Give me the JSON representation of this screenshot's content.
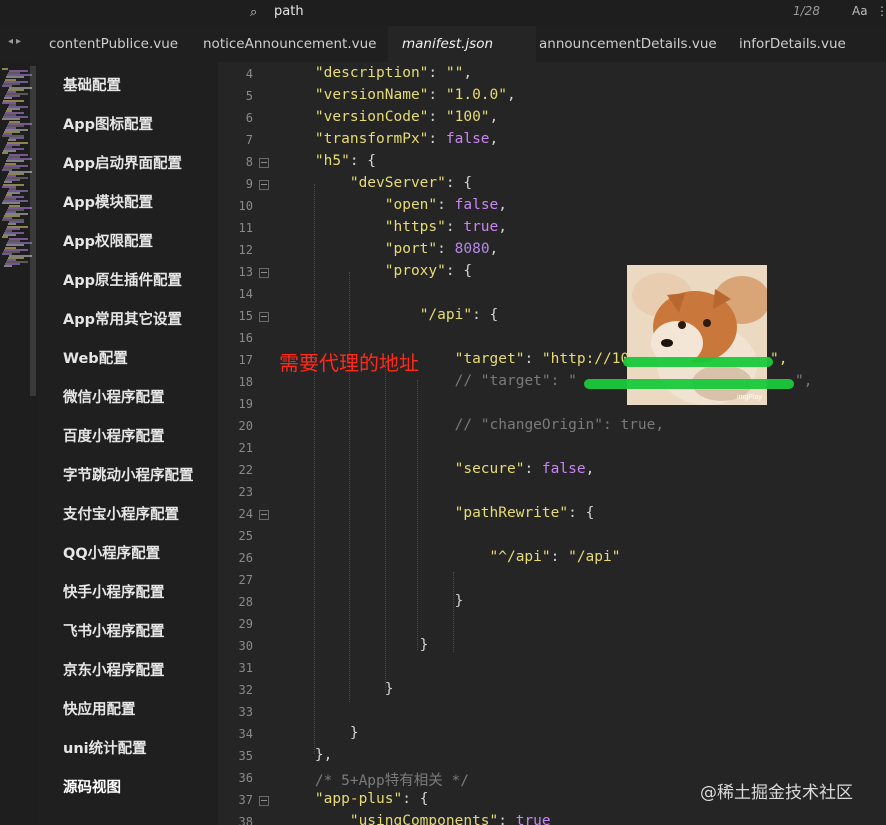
{
  "search": {
    "value": "path",
    "match_count": "1/28",
    "case_label": "Aa"
  },
  "tabs": [
    {
      "label": "contentPublice.vue",
      "active": false
    },
    {
      "label": "noticeAnnouncement.vue",
      "active": false
    },
    {
      "label": "manifest.json",
      "active": true
    },
    {
      "label": "announcementDetails.vue",
      "active": false
    },
    {
      "label": "inforDetails.vue",
      "active": false
    }
  ],
  "sidebar": {
    "items": [
      {
        "label": "基础配置"
      },
      {
        "label": "App图标配置"
      },
      {
        "label": "App启动界面配置"
      },
      {
        "label": "App模块配置"
      },
      {
        "label": "App权限配置"
      },
      {
        "label": "App原生插件配置"
      },
      {
        "label": "App常用其它设置"
      },
      {
        "label": "Web配置"
      },
      {
        "label": "微信小程序配置"
      },
      {
        "label": "百度小程序配置"
      },
      {
        "label": "字节跳动小程序配置"
      },
      {
        "label": "支付宝小程序配置"
      },
      {
        "label": "QQ小程序配置"
      },
      {
        "label": "快手小程序配置"
      },
      {
        "label": "飞书小程序配置"
      },
      {
        "label": "京东小程序配置"
      },
      {
        "label": "快应用配置"
      },
      {
        "label": "uni统计配置"
      },
      {
        "label": "源码视图"
      }
    ]
  },
  "editor": {
    "lines": [
      {
        "n": "4",
        "segs": [
          [
            "p",
            "    "
          ],
          [
            "s",
            "\"description\""
          ],
          [
            "p",
            ": "
          ],
          [
            "s",
            "\"\""
          ],
          [
            "p",
            ","
          ]
        ]
      },
      {
        "n": "5",
        "segs": [
          [
            "p",
            "    "
          ],
          [
            "s",
            "\"versionName\""
          ],
          [
            "p",
            ": "
          ],
          [
            "s",
            "\"1.0.0\""
          ],
          [
            "p",
            ","
          ]
        ]
      },
      {
        "n": "6",
        "segs": [
          [
            "p",
            "    "
          ],
          [
            "s",
            "\"versionCode\""
          ],
          [
            "p",
            ": "
          ],
          [
            "s",
            "\"100\""
          ],
          [
            "p",
            ","
          ]
        ]
      },
      {
        "n": "7",
        "segs": [
          [
            "p",
            "    "
          ],
          [
            "s",
            "\"transformPx\""
          ],
          [
            "p",
            ": "
          ],
          [
            "b",
            "false"
          ],
          [
            "p",
            ","
          ]
        ]
      },
      {
        "n": "8",
        "fold": true,
        "segs": [
          [
            "p",
            "    "
          ],
          [
            "s",
            "\"h5\""
          ],
          [
            "p",
            ": {"
          ]
        ]
      },
      {
        "n": "9",
        "fold": true,
        "segs": [
          [
            "p",
            "        "
          ],
          [
            "s",
            "\"devServer\""
          ],
          [
            "p",
            ": {"
          ]
        ]
      },
      {
        "n": "10",
        "segs": [
          [
            "p",
            "            "
          ],
          [
            "s",
            "\"open\""
          ],
          [
            "p",
            ": "
          ],
          [
            "b",
            "false"
          ],
          [
            "p",
            ","
          ]
        ]
      },
      {
        "n": "11",
        "segs": [
          [
            "p",
            "            "
          ],
          [
            "s",
            "\"https\""
          ],
          [
            "p",
            ": "
          ],
          [
            "b",
            "true"
          ],
          [
            "p",
            ","
          ]
        ]
      },
      {
        "n": "12",
        "segs": [
          [
            "p",
            "            "
          ],
          [
            "s",
            "\"port\""
          ],
          [
            "p",
            ": "
          ],
          [
            "n",
            "8080"
          ],
          [
            "p",
            ","
          ]
        ]
      },
      {
        "n": "13",
        "fold": true,
        "segs": [
          [
            "p",
            "            "
          ],
          [
            "s",
            "\"proxy\""
          ],
          [
            "p",
            ": {"
          ]
        ]
      },
      {
        "n": "14",
        "segs": []
      },
      {
        "n": "15",
        "fold": true,
        "segs": [
          [
            "p",
            "                "
          ],
          [
            "s",
            "\"/api\""
          ],
          [
            "p",
            ": {"
          ]
        ]
      },
      {
        "n": "16",
        "segs": []
      },
      {
        "n": "17",
        "segs": [
          [
            "p",
            "                    "
          ],
          [
            "s",
            "\"target\""
          ],
          [
            "p",
            ": "
          ],
          [
            "s",
            "\"http://10"
          ]
        ]
      },
      {
        "n": "18",
        "segs": [
          [
            "p",
            "                    "
          ],
          [
            "c",
            "// \"target\": \""
          ]
        ]
      },
      {
        "n": "19",
        "segs": []
      },
      {
        "n": "20",
        "segs": [
          [
            "p",
            "                    "
          ],
          [
            "c",
            "// \"changeOrigin\": true,"
          ]
        ]
      },
      {
        "n": "21",
        "segs": []
      },
      {
        "n": "22",
        "segs": [
          [
            "p",
            "                    "
          ],
          [
            "s",
            "\"secure\""
          ],
          [
            "p",
            ": "
          ],
          [
            "b",
            "false"
          ],
          [
            "p",
            ","
          ]
        ]
      },
      {
        "n": "23",
        "segs": []
      },
      {
        "n": "24",
        "fold": true,
        "segs": [
          [
            "p",
            "                    "
          ],
          [
            "s",
            "\"pathRewrite\""
          ],
          [
            "p",
            ": {"
          ]
        ]
      },
      {
        "n": "25",
        "segs": []
      },
      {
        "n": "26",
        "segs": [
          [
            "p",
            "                        "
          ],
          [
            "s",
            "\"^/api\""
          ],
          [
            "p",
            ": "
          ],
          [
            "s",
            "\"/api\""
          ]
        ]
      },
      {
        "n": "27",
        "segs": []
      },
      {
        "n": "28",
        "segs": [
          [
            "p",
            "                    }"
          ]
        ]
      },
      {
        "n": "29",
        "segs": []
      },
      {
        "n": "30",
        "segs": [
          [
            "p",
            "                }"
          ]
        ]
      },
      {
        "n": "31",
        "segs": []
      },
      {
        "n": "32",
        "segs": [
          [
            "p",
            "            }"
          ]
        ]
      },
      {
        "n": "33",
        "segs": []
      },
      {
        "n": "34",
        "segs": [
          [
            "p",
            "        }"
          ]
        ]
      },
      {
        "n": "35",
        "segs": [
          [
            "p",
            "    },"
          ]
        ]
      },
      {
        "n": "36",
        "segs": [
          [
            "p",
            "    "
          ],
          [
            "c",
            "/* 5+App特有相关 */"
          ]
        ]
      },
      {
        "n": "37",
        "fold": true,
        "segs": [
          [
            "p",
            "    "
          ],
          [
            "s",
            "\"app-plus\""
          ],
          [
            "p",
            ": {"
          ]
        ]
      },
      {
        "n": "38",
        "segs": [
          [
            "p",
            "        "
          ],
          [
            "s",
            "\"usingComponents\""
          ],
          [
            "p",
            ": "
          ],
          [
            "b",
            "true"
          ]
        ]
      }
    ],
    "line_18_tail": "\",",
    "line_17_tail": "\","
  },
  "annotation": "需要代理的地址",
  "sticker_label": "imgPlay",
  "watermark": "@稀土掘金技术社区",
  "colors": {
    "string": "#e6db74",
    "boolean": "#c986f2",
    "number": "#b48ae8",
    "comment": "#7a7a7a",
    "annotation": "#ff2a1a",
    "redaction": "#19c93a"
  }
}
